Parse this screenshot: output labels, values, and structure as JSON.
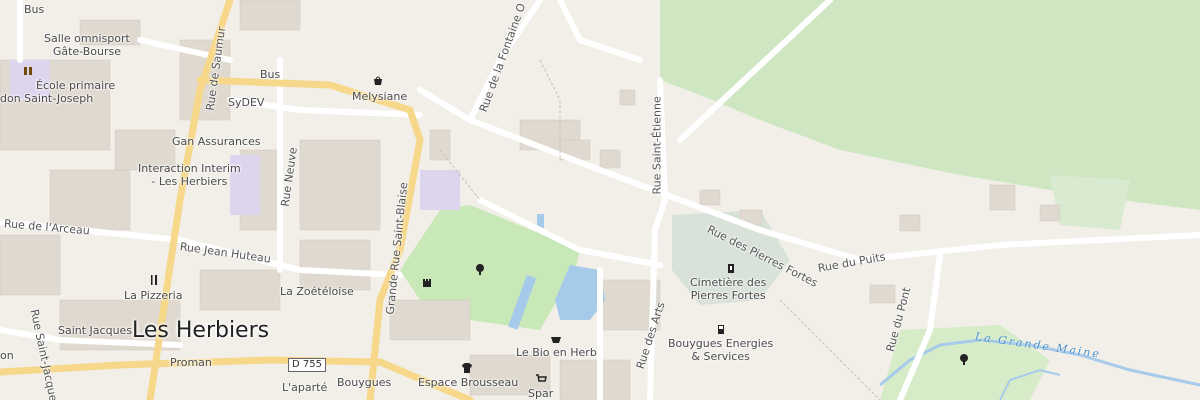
{
  "map": {
    "town": "Les Herbiers",
    "road_shield": "D 755",
    "river": "La Grande Maine",
    "streets": {
      "rue_de_saumur": "Rue de Saumur",
      "rue_fontaine": "Rue de la Fontaine O",
      "rue_saint_etienne": "Rue Saint-Étienne",
      "rue_pierres_fortes": "Rue des Pierres Fortes",
      "rue_du_puits": "Rue du Puits",
      "rue_arceau": "Rue de l'Arceau",
      "rue_jean_huteau": "Rue Jean Huteau",
      "rue_neuve": "Rue Neuve",
      "grande_rue": "Grande Rue Saint-Blaise",
      "rue_saint_jacques": "Rue Saint-Jacques",
      "rue_des_arts": "Rue des Arts",
      "rue_du_pont": "Rue du Pont"
    },
    "places": {
      "salle_omnisport": [
        "Salle omnisport",
        "Gâte-Bourse"
      ],
      "ecole": [
        "École primaire",
        "don Saint-Joseph"
      ],
      "sydev": "SyDEV",
      "melysiane": "Melysiane",
      "gan": "Gan Assurances",
      "interaction": [
        "Interaction Interim",
        "- Les Herbiers"
      ],
      "pizzeria": "La Pizzeria",
      "zoeteloise": "La Zoétéloise",
      "saint_jacques": "Saint Jacques",
      "proman": "Proman",
      "aparte": "L'aparté",
      "bouygues": "Bouygues",
      "espace_brousseau": "Espace Brousseau",
      "spar": "Spar",
      "bio_en_herb": "Le Bio en Herb",
      "cimetiere": [
        "Cimetière des",
        "Pierres Fortes"
      ],
      "bouygues_energies": [
        "Bouygues Energies",
        "& Services"
      ],
      "on": "on",
      "bus1": "Bus",
      "bus2": "Bus"
    },
    "icons": [
      "school-icon",
      "shop-icon",
      "tree-icon",
      "castle-icon",
      "restaurant-icon",
      "clothes-icon",
      "supermarket-icon",
      "basket-icon",
      "cemetery-icon",
      "fuel-icon"
    ]
  }
}
